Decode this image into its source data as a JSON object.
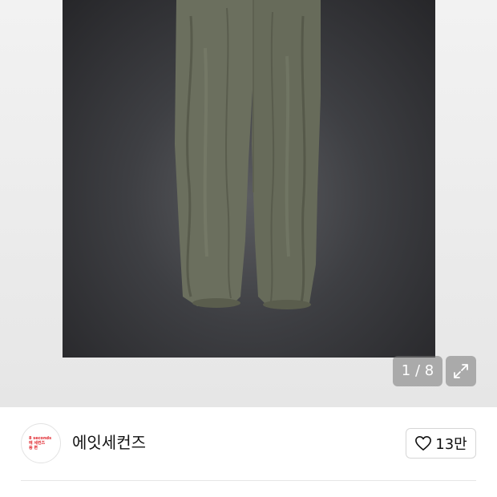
{
  "gallery": {
    "image_alt": "khaki parachute pants",
    "counter": "1 / 8",
    "current_index": 1,
    "total": 8,
    "expand_icon": "expand-icon"
  },
  "shop": {
    "name": "에잇세컨즈",
    "logo_lines": [
      "8 seconds",
      "에 세컨즈",
      "쓩 편"
    ],
    "like_icon": "heart-icon",
    "like_count": "13만"
  },
  "colors": {
    "logo_red": "#e0242b",
    "photo_bg": "#3e3f43",
    "pants": "#6b6f5e"
  }
}
